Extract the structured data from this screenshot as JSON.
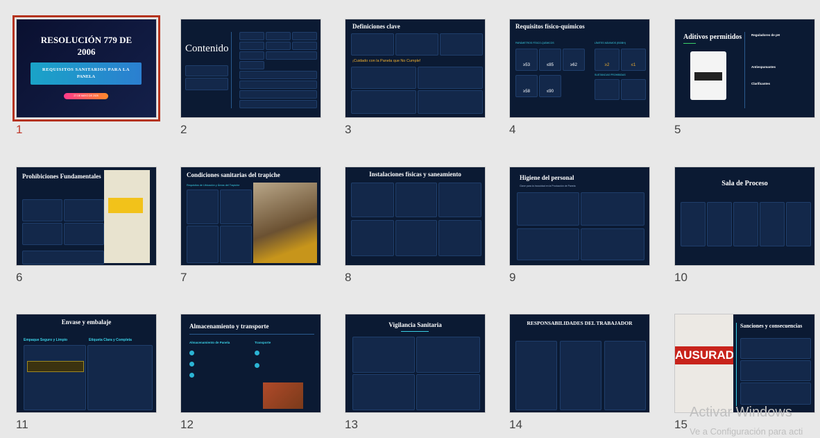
{
  "slides": [
    {
      "number": "1",
      "title_line1": "RESOLUCIÓN 779 DE",
      "title_line2": "2006",
      "subtitle_line1": "REQUISITOS SANITARIOS PARA LA",
      "subtitle_line2": "PANELA",
      "date": "27 DE MAYO DE 2025"
    },
    {
      "number": "2",
      "title": "Contenido"
    },
    {
      "number": "3",
      "title": "Definiciones clave",
      "alert": "¡Cuidado con la Panela que No Cumple!"
    },
    {
      "number": "4",
      "title": "Requisitos físico-químicos",
      "section1": "PARÁMETROS FÍSICO-QUÍMICOS",
      "section2": "LÍMITES MÁXIMOS (BS/BH)",
      "section3": "SUSTANCIAS PROHIBIDAS",
      "values": [
        "≥53",
        "≤85",
        "≥62",
        "≥58",
        "≤90",
        "≥2",
        "≤1"
      ]
    },
    {
      "number": "5",
      "title": "Aditivos permitidos",
      "items": [
        "Reguladores de pH",
        "Antiespumantes",
        "Clarificantes"
      ]
    },
    {
      "number": "6",
      "title": "Prohibiciones Fundamentales"
    },
    {
      "number": "7",
      "title": "Condiciones sanitarias del trapiche",
      "subtitle": "Requisitos de Ubicación y Áreas del Trapiche"
    },
    {
      "number": "8",
      "title": "Instalaciones físicas y saneamiento"
    },
    {
      "number": "9",
      "title": "Higiene del personal",
      "subtitle": "Clave para la Inocuidad en la Producción de Panela"
    },
    {
      "number": "10",
      "title": "Sala de Proceso"
    },
    {
      "number": "11",
      "title": "Envase y embalaje",
      "col1": "Empaque Seguro y Limpio",
      "col2": "Etiqueta Clara y Completa"
    },
    {
      "number": "12",
      "title": "Almacenamiento y transporte",
      "col1": "Almacenamiento de Panela",
      "col2": "Transporte"
    },
    {
      "number": "13",
      "title": "Vigilancia Sanitaria"
    },
    {
      "number": "14",
      "title": "RESPONSABILIDADES DEL TRABAJADOR"
    },
    {
      "number": "15",
      "title": "Sanciones y consecuencias",
      "image_text": "AUSURADO"
    }
  ],
  "watermark": {
    "line1": "Activar Windows",
    "line2": "Ve a Configuración para acti"
  }
}
